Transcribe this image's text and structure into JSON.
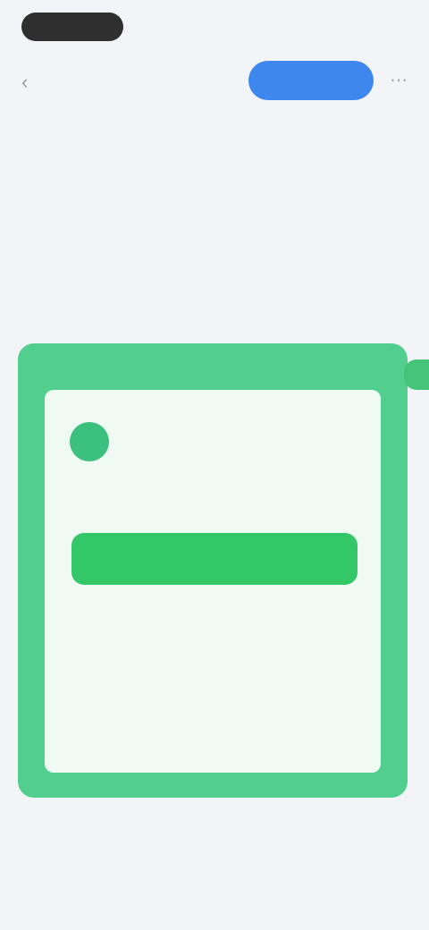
{
  "status_bar": {
    "time": "",
    "right": ""
  },
  "header": {
    "back_icon": "chevron-left-icon",
    "cta_label": "",
    "more_icon": "more-icon"
  },
  "article": {
    "paragraph_1": "",
    "paragraph_2": "",
    "link_text": ""
  },
  "card": {
    "logo_letter": "",
    "caption": "",
    "title": "",
    "sub_left": "",
    "sub_right": "",
    "button_label": ""
  },
  "footer": {
    "text": "",
    "pager": ""
  },
  "colors": {
    "cta_blue": "#3d87ee",
    "card_green": "#52cf8e",
    "button_green": "#33c767"
  }
}
